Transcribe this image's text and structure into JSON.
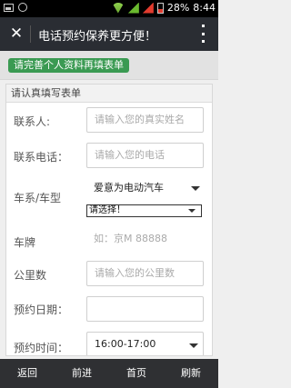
{
  "status": {
    "battery": "28%",
    "time": "8:44"
  },
  "topbar": {
    "close_icon": "close-icon",
    "title": "电话预约保养更方便！",
    "menu_icon": "more-vertical-icon"
  },
  "notice": "请完善个人资料再填表单",
  "form": {
    "header": "请认真填写表单",
    "contact": {
      "label": "联系人:",
      "placeholder": "请输入您的真实姓名"
    },
    "phone": {
      "label": "联系电话：",
      "placeholder": "请输入您的电话"
    },
    "car": {
      "label": "车系/车型",
      "series": "爱意为电动汽车",
      "model": "请选择！"
    },
    "plate": {
      "label": "车牌",
      "placeholder": "如：京M 88888"
    },
    "mileage": {
      "label": "公里数",
      "placeholder": "请输入您的公里数"
    },
    "date": {
      "label": "预约日期：",
      "value": ""
    },
    "time": {
      "label": "预约时间：",
      "value": "16:00-17:00"
    }
  },
  "bottom_nav": [
    "返回",
    "前进",
    "首页",
    "刷新"
  ]
}
